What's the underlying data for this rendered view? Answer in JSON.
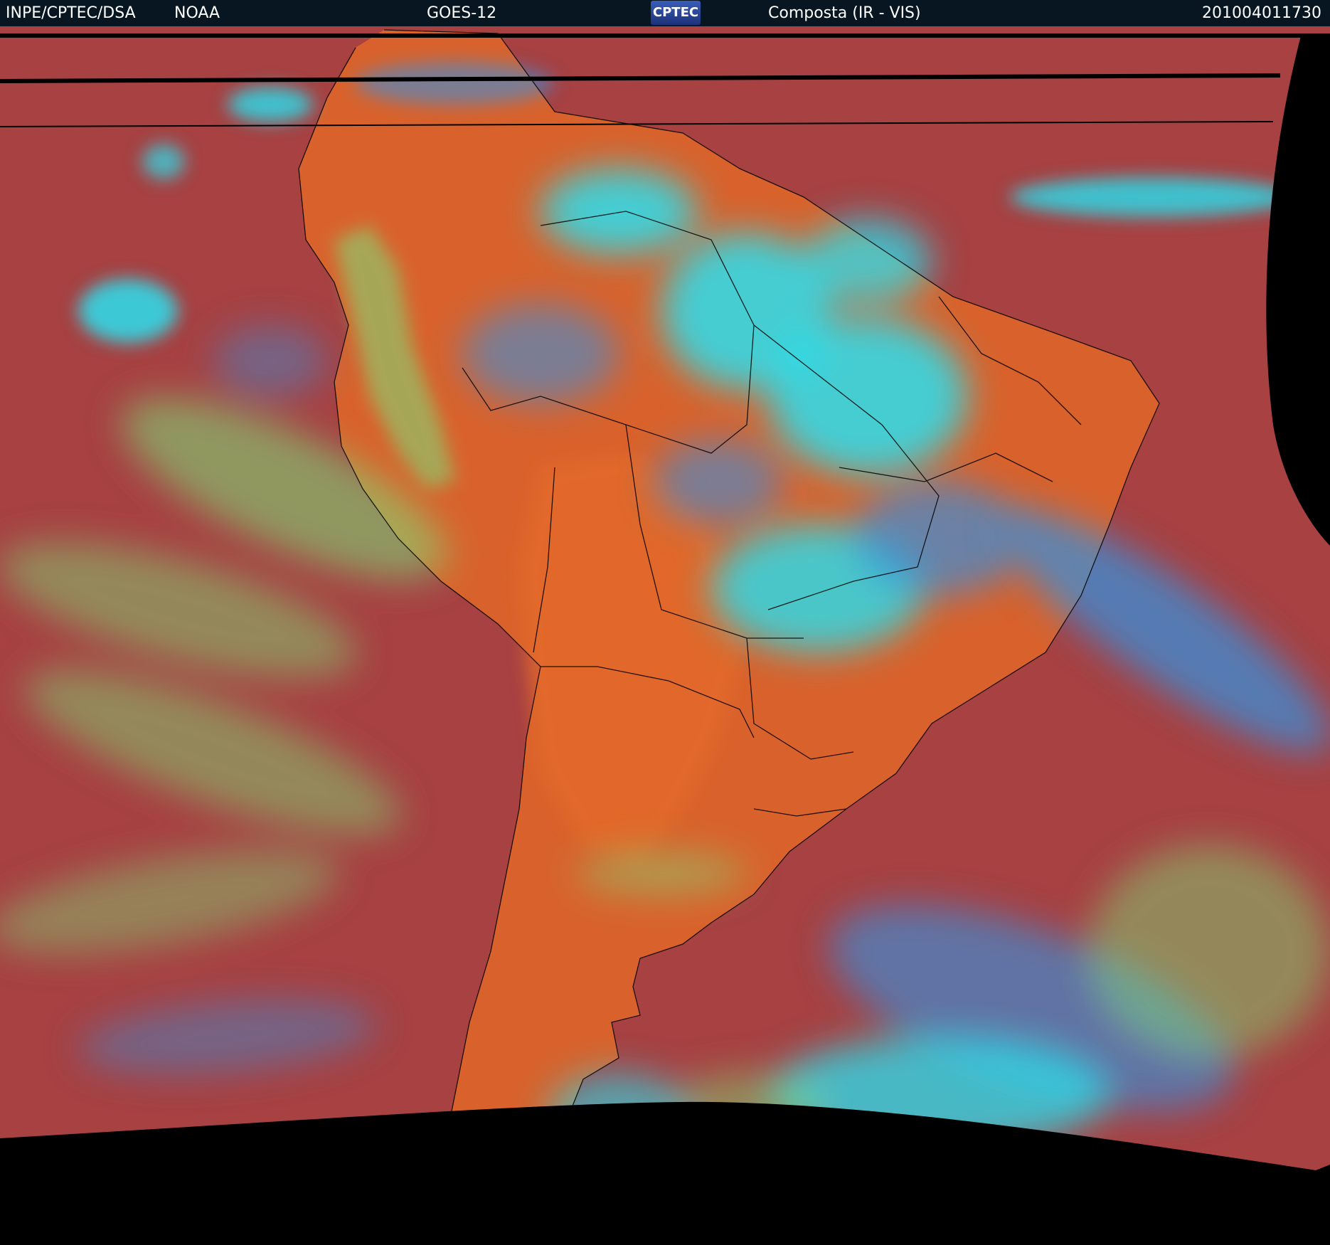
{
  "header": {
    "agency": "INPE/CPTEC/DSA",
    "partner": "NOAA",
    "satellite": "GOES-12",
    "logo_text": "CPTEC",
    "product": "Composta (IR - VIS)",
    "timestamp": "201004011730"
  },
  "colors": {
    "ocean": "#a74142",
    "land_warm": "#d9622c",
    "cloud_cold": "#28e0f0",
    "cloud_mid": "#3a8fd8",
    "cloud_low": "#7ee07a",
    "border_lines": "#000000",
    "header_bg": "#071621"
  }
}
